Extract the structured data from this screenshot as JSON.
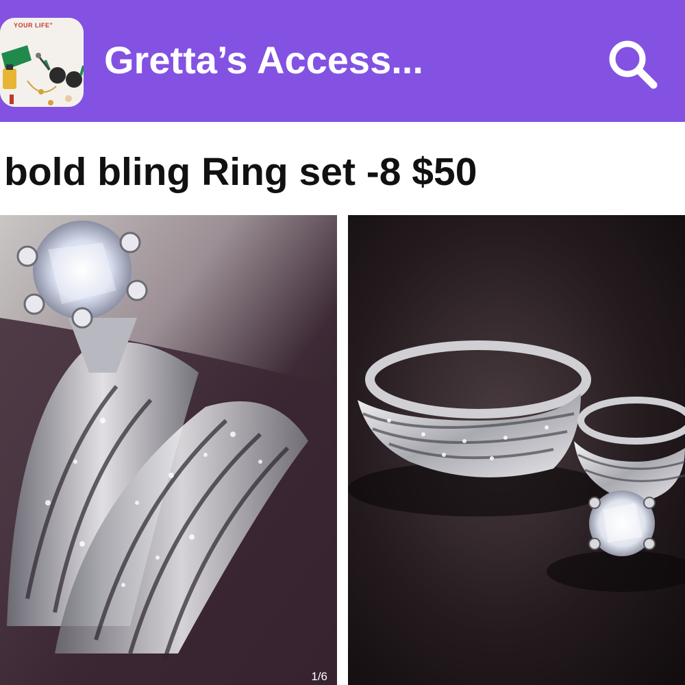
{
  "header": {
    "shop_name": "Gretta’s Access...",
    "logo_tagline": "YOUR LIFE\"",
    "background_color": "#8352e2",
    "logo_icon": "shop-logo-image",
    "search_icon": "search-icon"
  },
  "listing": {
    "title": "bold bling Ring set -8 $50"
  },
  "gallery": {
    "counter": "1/6",
    "photos": [
      {
        "icon": "ring-set-photo-closeup"
      },
      {
        "icon": "ring-set-photo-pair"
      }
    ]
  }
}
